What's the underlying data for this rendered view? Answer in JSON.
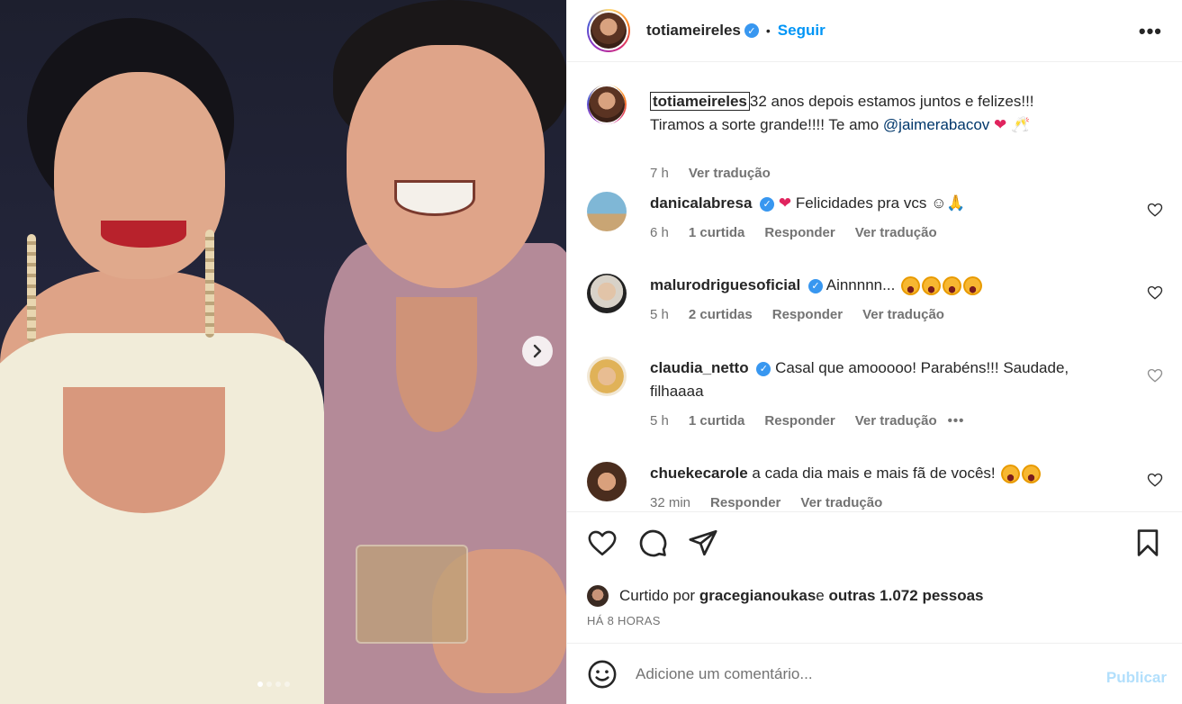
{
  "colors": {
    "accent": "#0095f6",
    "verified": "#3897f0",
    "muted": "#737373",
    "publish_disabled": "#b2dffc",
    "heart": "#e0245e"
  },
  "post": {
    "carousel": {
      "total": 4,
      "active": 1,
      "next_icon": "chevron-right-icon"
    }
  },
  "header": {
    "username": "totiameireles",
    "bullet": "•",
    "follow_label": "Seguir",
    "more_icon": "•••"
  },
  "caption": {
    "username": "totiameireles",
    "text_line1": "32 anos depois estamos juntos e felizes!!!",
    "text_line2_prefix": "Tiramos a sorte grande!!!! Te amo ",
    "mention": "@jaimerabacov",
    "emoji_heart": "❤",
    "emoji_toast": "🥂",
    "time": "7 h",
    "translate": "Ver tradução"
  },
  "comments": [
    {
      "username": "danicalabresa",
      "emoji_heart": "❤",
      "text": " Felicidades pra vcs ☺🙏",
      "time": "6 h",
      "likes": "1 curtida",
      "reply": "Responder",
      "translate": "Ver tradução"
    },
    {
      "username": "malurodriguesoficial",
      "text": " Ainnnnn...",
      "emoji_count": 4,
      "time": "5 h",
      "likes": "2 curtidas",
      "reply": "Responder",
      "translate": "Ver tradução"
    },
    {
      "username": "claudia_netto",
      "text": " Casal que amooooo! Parabéns!!! Saudade,",
      "text_line2": "filhaaaa",
      "time": "5 h",
      "likes": "1 curtida",
      "reply": "Responder",
      "translate": "Ver tradução",
      "options": "•••"
    },
    {
      "username": "chuekecarole",
      "text": " a cada dia mais e mais fã de vocês! ",
      "emoji_count": 2,
      "time": "32 min",
      "reply": "Responder",
      "translate": "Ver tradução"
    }
  ],
  "likes": {
    "prefix": "Curtido por ",
    "user": "gracegianoukas",
    "middle": " e ",
    "others": "outras 1.072 pessoas"
  },
  "time_ago": "HÁ 8 HORAS",
  "add_comment": {
    "placeholder": "Adicione um comentário...",
    "publish": "Publicar"
  }
}
